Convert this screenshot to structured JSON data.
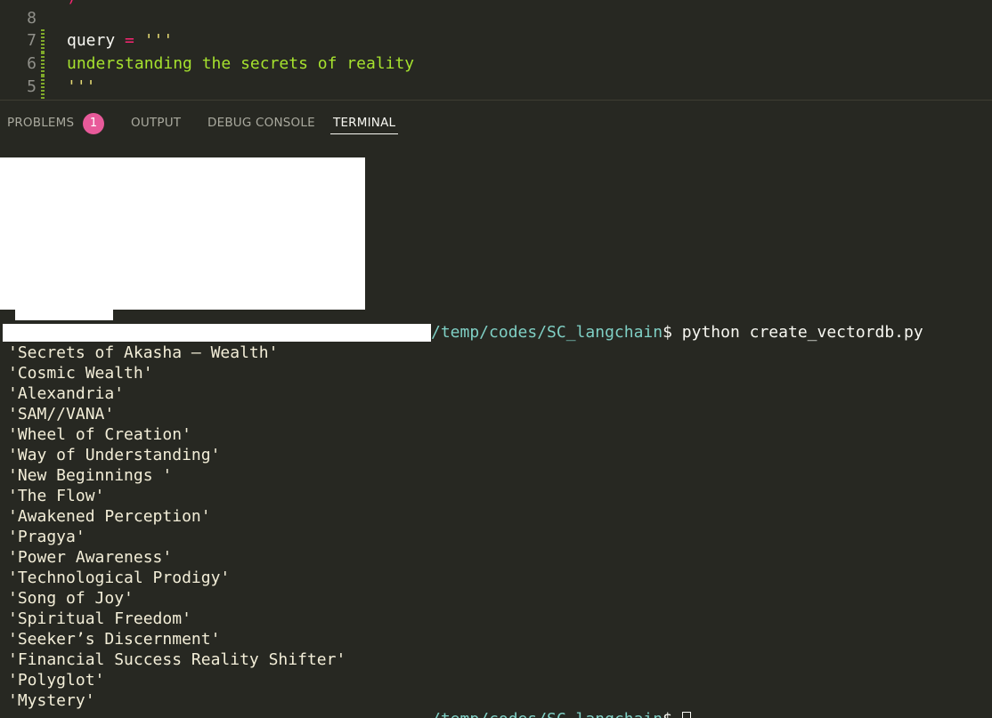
{
  "editor": {
    "lines": [
      {
        "no": "8",
        "text": ""
      },
      {
        "no": "7",
        "var": "query",
        "op": " = ",
        "str": "'''"
      },
      {
        "no": "6",
        "text": "understanding the secrets of reality"
      },
      {
        "no": "5",
        "text": "'''"
      }
    ],
    "partial_top_char": ")"
  },
  "panel": {
    "tabs": [
      {
        "label": "PROBLEMS"
      },
      {
        "label": "OUTPUT"
      },
      {
        "label": "DEBUG CONSOLE"
      },
      {
        "label": "TERMINAL"
      }
    ],
    "problems_count": "1",
    "active_tab": "TERMINAL"
  },
  "terminal": {
    "prompt_path": "/temp/codes/SC_langchain",
    "prompt_symbol": "$",
    "command": " python create_vectordb.py",
    "output": [
      "'Secrets of Akasha – Wealth'",
      "'Cosmic Wealth'",
      "'Alexandria'",
      "'SAM//VANA'",
      "'Wheel of Creation'",
      "'Way of Understanding'",
      "'New Beginnings '",
      "'The Flow'",
      "'Awakened Perception'",
      "'Pragya'",
      "'Power Awareness'",
      "'Technological Prodigy'",
      "'Song of Joy'",
      "'Spiritual Freedom'",
      "'Seeker’s Discernment'",
      "'Financial Success Reality Shifter'",
      "'Polyglot'",
      "'Mystery'"
    ],
    "final_prompt_path": "/temp/codes/SC_langchain",
    "final_prompt_symbol": "$"
  },
  "colors": {
    "background": "#272822",
    "path": "#7fcfc4",
    "string": "#e6db74",
    "operator": "#f92672",
    "badge": "#e85a9a"
  }
}
